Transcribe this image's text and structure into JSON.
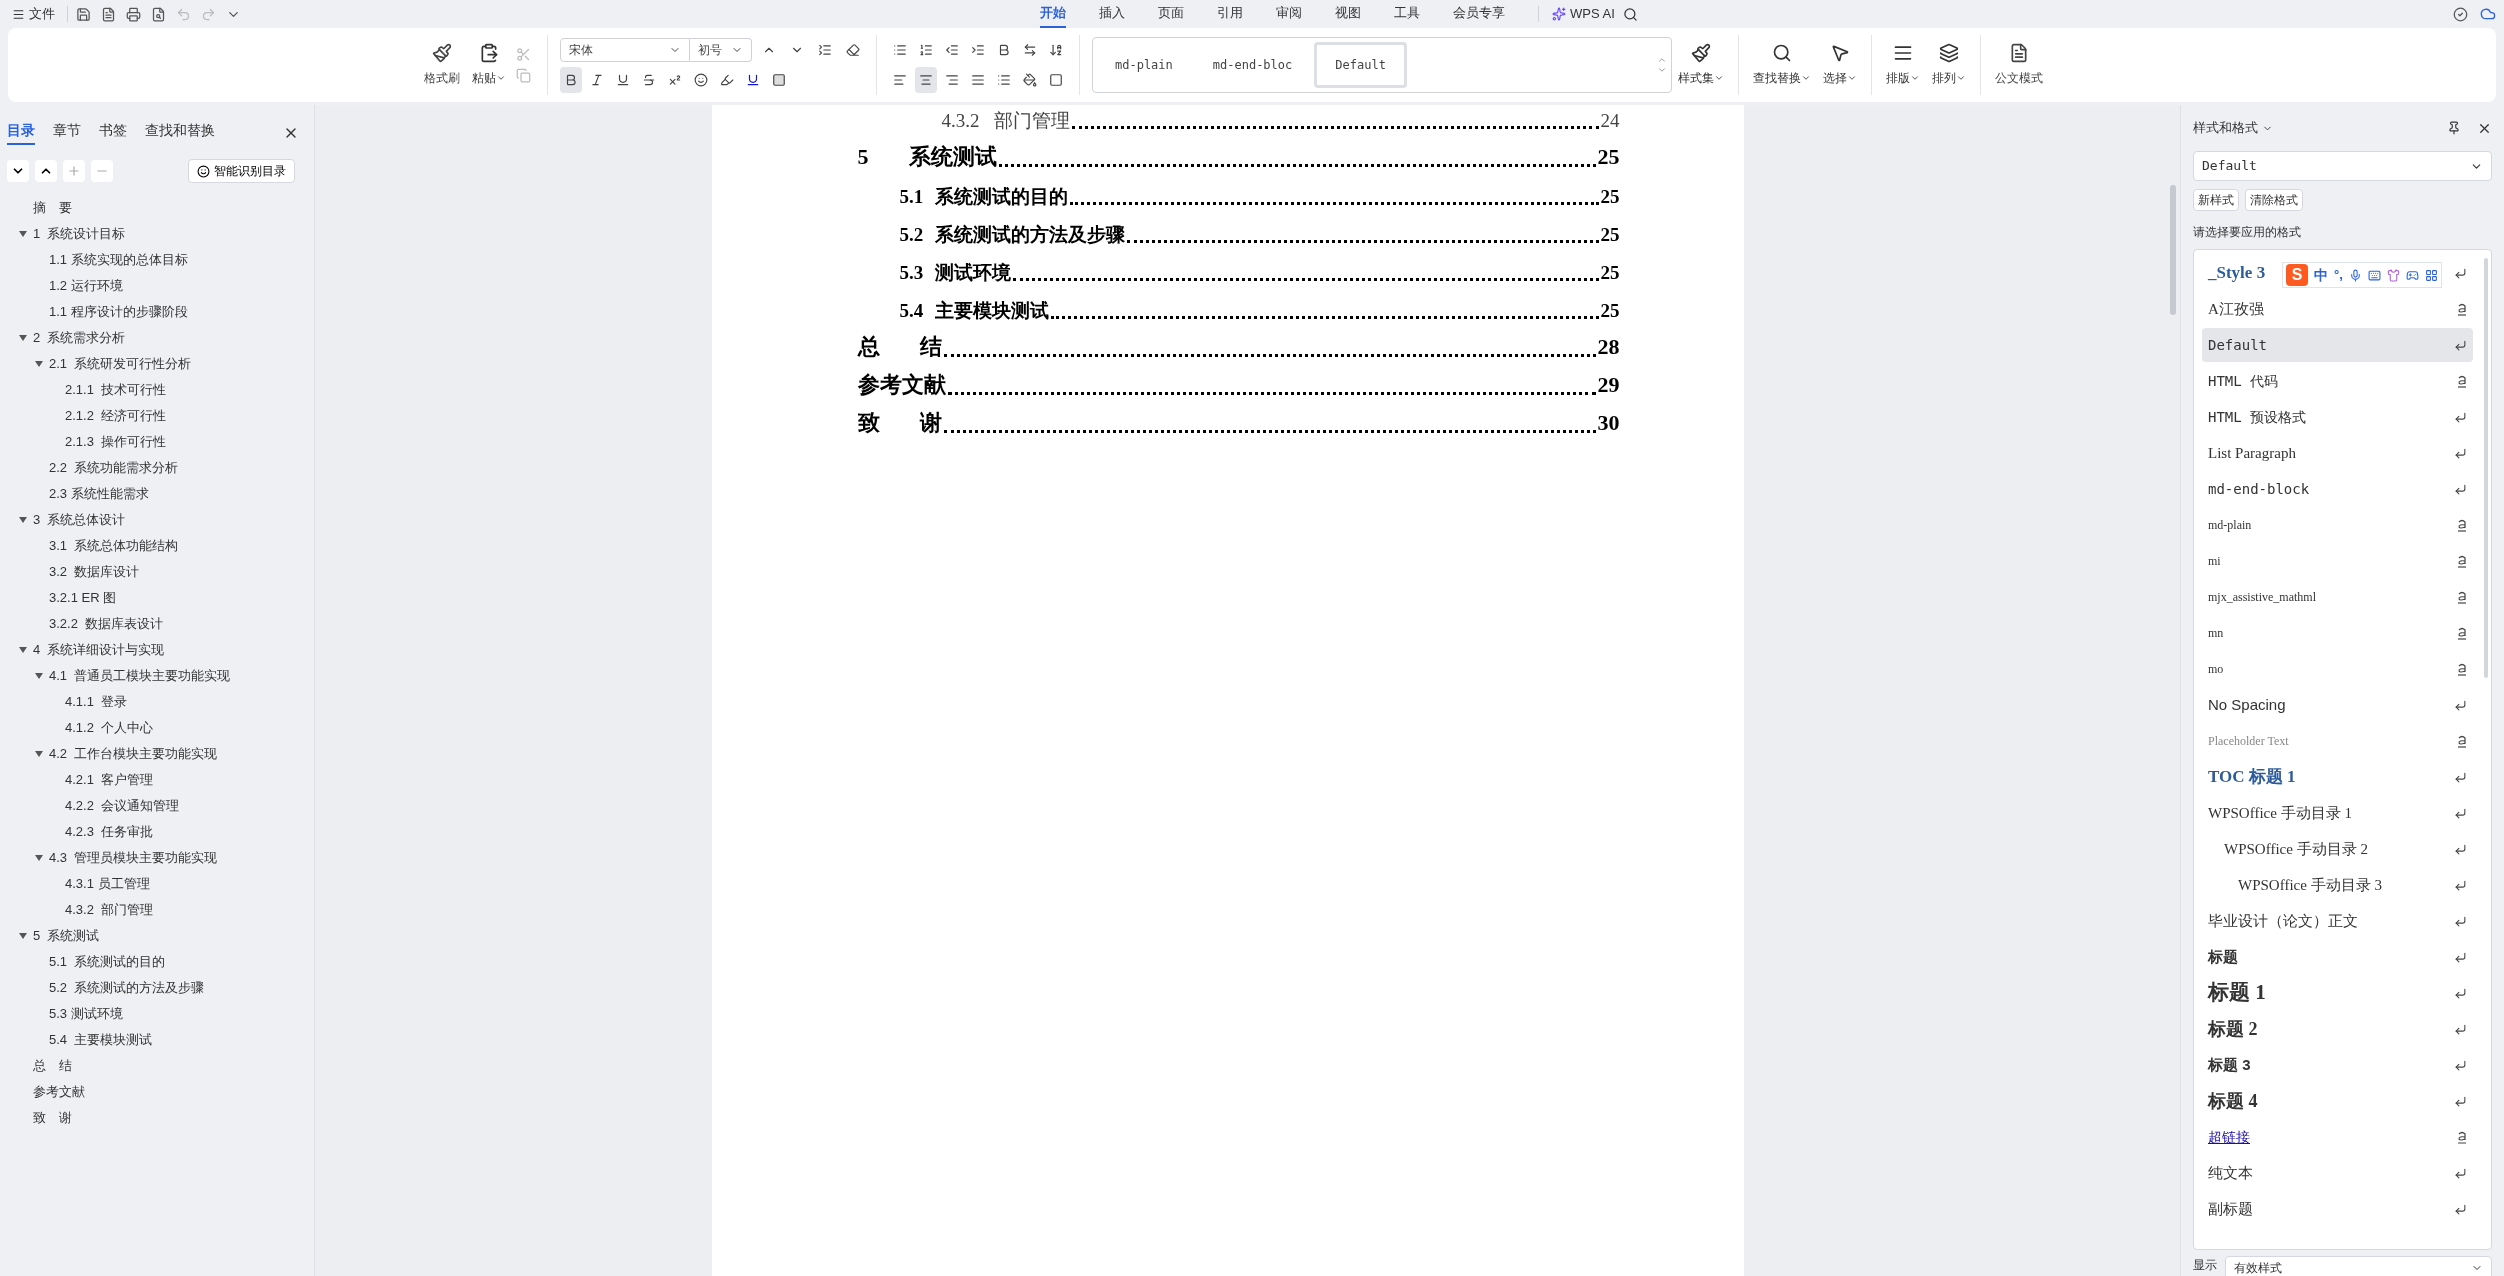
{
  "topbar": {
    "file_label": "文件",
    "tabs": [
      {
        "label": "开始",
        "selected": true
      },
      {
        "label": "插入",
        "selected": false
      },
      {
        "label": "页面",
        "selected": false
      },
      {
        "label": "引用",
        "selected": false
      },
      {
        "label": "审阅",
        "selected": false
      },
      {
        "label": "视图",
        "selected": false
      },
      {
        "label": "工具",
        "selected": false
      },
      {
        "label": "会员专享",
        "selected": false
      }
    ],
    "ai_label": "WPS AI"
  },
  "ribbon": {
    "format_painter": "格式刷",
    "paste": "粘贴",
    "font": "宋体",
    "font_size": "初号",
    "bold_active": true,
    "align_center_active": true,
    "gallery": [
      {
        "label": "md-plain",
        "selected": false
      },
      {
        "label": "md-end-bloc",
        "selected": false
      },
      {
        "label": "Default",
        "selected": true
      }
    ],
    "tools": [
      "样式集",
      "查找替换",
      "选择",
      "排版",
      "排列",
      "公文模式"
    ]
  },
  "sidebar": {
    "tabs": [
      {
        "label": "目录",
        "selected": true
      },
      {
        "label": "章节",
        "selected": false
      },
      {
        "label": "书签",
        "selected": false
      },
      {
        "label": "查找和替换",
        "selected": false
      }
    ],
    "smart_button": "智能识别目录",
    "tree": [
      {
        "label": "摘　要"
      },
      {
        "label": "1  系统设计目标",
        "expanded": true,
        "children": [
          {
            "label": "1.1 系统实现的总体目标"
          },
          {
            "label": "1.2 运行环境"
          },
          {
            "label": "1.1 程序设计的步骤阶段"
          }
        ]
      },
      {
        "label": "2  系统需求分析",
        "expanded": true,
        "children": [
          {
            "label": "2.1  系统研发可行性分析",
            "expanded": true,
            "children": [
              {
                "label": "2.1.1  技术可行性"
              },
              {
                "label": "2.1.2  经济可行性"
              },
              {
                "label": "2.1.3  操作可行性"
              }
            ]
          },
          {
            "label": "2.2  系统功能需求分析"
          },
          {
            "label": "2.3 系统性能需求"
          }
        ]
      },
      {
        "label": "3  系统总体设计",
        "expanded": true,
        "children": [
          {
            "label": "3.1  系统总体功能结构"
          },
          {
            "label": "3.2  数据库设计"
          },
          {
            "label": "3.2.1 ER 图"
          },
          {
            "label": "3.2.2  数据库表设计"
          }
        ]
      },
      {
        "label": "4  系统详细设计与实现",
        "expanded": true,
        "children": [
          {
            "label": "4.1  普通员工模块主要功能实现",
            "expanded": true,
            "children": [
              {
                "label": "4.1.1  登录"
              },
              {
                "label": "4.1.2  个人中心"
              }
            ]
          },
          {
            "label": "4.2  工作台模块主要功能实现",
            "expanded": true,
            "children": [
              {
                "label": "4.2.1  客户管理"
              },
              {
                "label": "4.2.2  会议通知管理"
              },
              {
                "label": "4.2.3  任务审批"
              }
            ]
          },
          {
            "label": "4.3  管理员模块主要功能实现",
            "expanded": true,
            "children": [
              {
                "label": "4.3.1 员工管理"
              },
              {
                "label": "4.3.2  部门管理"
              }
            ]
          }
        ]
      },
      {
        "label": "5  系统测试",
        "expanded": true,
        "children": [
          {
            "label": "5.1  系统测试的目的"
          },
          {
            "label": "5.2  系统测试的方法及步骤"
          },
          {
            "label": "5.3 测试环境"
          },
          {
            "label": "5.4  主要模块测试"
          }
        ]
      },
      {
        "label": "总　结"
      },
      {
        "label": "参考文献"
      },
      {
        "label": "致　谢"
      }
    ]
  },
  "document": {
    "toc": [
      {
        "kind": "subsection",
        "number": "4.3.2",
        "title": "部门管理",
        "page": "24"
      },
      {
        "kind": "chapter",
        "number": "5",
        "title": "系统测试",
        "page": "25"
      },
      {
        "kind": "section",
        "number": "5.1",
        "title": "系统测试的目的",
        "page": "25"
      },
      {
        "kind": "section",
        "number": "5.2",
        "title": "系统测试的方法及步骤",
        "page": "25"
      },
      {
        "kind": "section",
        "number": "5.3",
        "title": "测试环境",
        "page": "25"
      },
      {
        "kind": "section",
        "number": "5.4",
        "title": "主要模块测试",
        "page": "25"
      },
      {
        "kind": "chapter",
        "number": "总",
        "title": "结",
        "page": "28"
      },
      {
        "kind": "chapter",
        "title": "参考文献",
        "page": "29"
      },
      {
        "kind": "chapter",
        "number": "致",
        "title": "谢",
        "page": "30"
      }
    ]
  },
  "styles_panel": {
    "title": "样式和格式",
    "current": "Default",
    "new_button": "新样式",
    "clear_button": "清除格式",
    "prompt": "请选择要应用的格式",
    "styles": [
      {
        "label": "_Style 3",
        "character_style": false,
        "kind": "heading",
        "selected": false
      },
      {
        "label": "A江孜强",
        "character_style": true,
        "kind": "serif",
        "selected": false
      },
      {
        "label": "Default",
        "character_style": false,
        "kind": "mono",
        "selected": true
      },
      {
        "label": "HTML 代码",
        "character_style": true,
        "kind": "mono",
        "selected": false
      },
      {
        "label": "HTML 预设格式",
        "character_style": false,
        "kind": "mono",
        "selected": false
      },
      {
        "label": "List Paragraph",
        "character_style": false,
        "kind": "serif",
        "selected": false
      },
      {
        "label": "md-end-block",
        "character_style": false,
        "kind": "mono",
        "selected": false
      },
      {
        "label": "md-plain",
        "character_style": true,
        "kind": "small",
        "selected": false
      },
      {
        "label": "mi",
        "character_style": true,
        "kind": "small",
        "selected": false
      },
      {
        "label": "mjx_assistive_mathml",
        "character_style": true,
        "kind": "small",
        "selected": false
      },
      {
        "label": "mn",
        "character_style": true,
        "kind": "small",
        "selected": false
      },
      {
        "label": "mo",
        "character_style": true,
        "kind": "small",
        "selected": false
      },
      {
        "label": "No Spacing",
        "character_style": false,
        "kind": "sans",
        "selected": false
      },
      {
        "label": "Placeholder Text",
        "character_style": true,
        "kind": "placeholder",
        "selected": false
      },
      {
        "label": "TOC 标题 1",
        "character_style": false,
        "kind": "heading",
        "selected": false
      },
      {
        "label": "WPSOffice 手动目录 1",
        "character_style": false,
        "kind": "serif",
        "selected": false
      },
      {
        "label": "WPSOffice 手动目录 2",
        "character_style": false,
        "kind": "indented",
        "selected": false
      },
      {
        "label": "WPSOffice 手动目录 3",
        "character_style": false,
        "kind": "doubleindented",
        "selected": false
      },
      {
        "label": "毕业设计（论文）正文",
        "character_style": false,
        "kind": "sans",
        "selected": false
      },
      {
        "label": "标题",
        "character_style": false,
        "kind": "bold",
        "selected": false
      },
      {
        "label": "标题 1",
        "character_style": false,
        "kind": "large",
        "selected": false
      },
      {
        "label": "标题 2",
        "character_style": false,
        "kind": "medium",
        "selected": false
      },
      {
        "label": "标题 3",
        "character_style": false,
        "kind": "bold",
        "selected": false
      },
      {
        "label": "标题 4",
        "character_style": false,
        "kind": "medium",
        "selected": false
      },
      {
        "label": "超链接",
        "character_style": true,
        "kind": "link",
        "selected": false
      },
      {
        "label": "纯文本",
        "character_style": false,
        "kind": "sans",
        "selected": false
      },
      {
        "label": "副标题",
        "character_style": false,
        "kind": "sans",
        "selected": false
      }
    ],
    "show_label": "显示",
    "show_value": "有效样式"
  },
  "ime_bar": {
    "logo": "S",
    "mode": "中",
    "punct": "°,"
  }
}
